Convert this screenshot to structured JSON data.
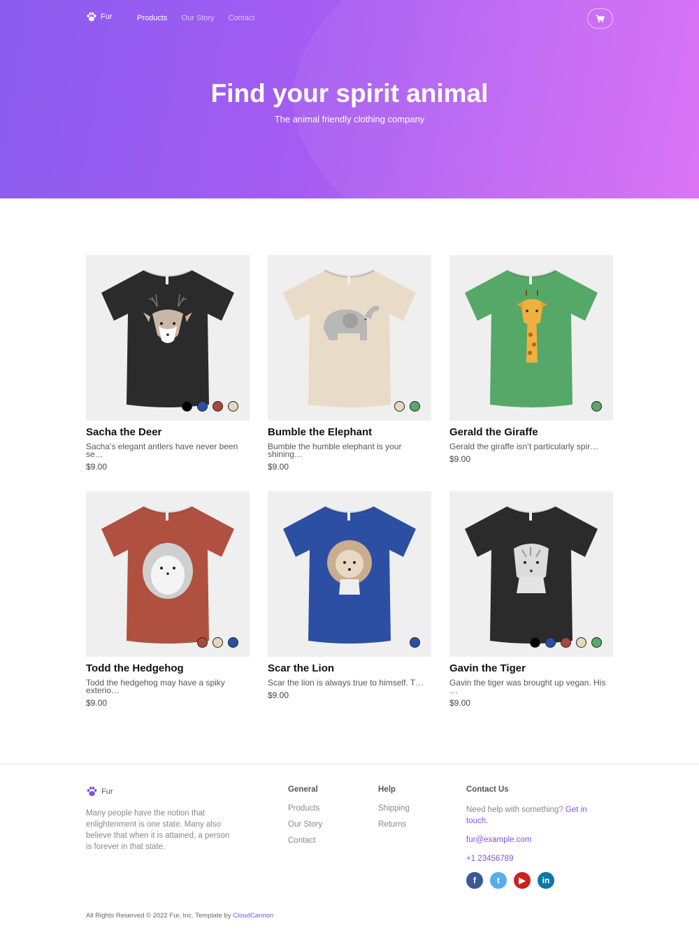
{
  "header": {
    "brand": "Fur",
    "nav": [
      {
        "label": "Products",
        "active": true
      },
      {
        "label": "Our Story",
        "active": false
      },
      {
        "label": "Contact",
        "active": false
      }
    ],
    "cart_icon": "cart-icon"
  },
  "hero": {
    "title": "Find your spirit animal",
    "subtitle": "The animal friendly clothing company"
  },
  "products": [
    {
      "name": "Sacha the Deer",
      "desc": "Sacha’s elegant antlers have never been se…",
      "price": "$9.00",
      "shirt": "#2b2b2b",
      "animal": "deer",
      "swatches": [
        "#000000",
        "#2b4fa8",
        "#a84a3a",
        "#e6d6c0"
      ]
    },
    {
      "name": "Bumble the Elephant",
      "desc": "Bumble the humble elephant is your shining…",
      "price": "$9.00",
      "shirt": "#e8dcc8",
      "animal": "elephant",
      "swatches": [
        "#e6d6c0",
        "#5aa86a"
      ]
    },
    {
      "name": "Gerald the Giraffe",
      "desc": "Gerald the giraffe isn’t particularly spir…",
      "price": "$9.00",
      "shirt": "#55a868",
      "animal": "giraffe",
      "swatches": [
        "#5aa86a"
      ]
    },
    {
      "name": "Todd the Hedgehog",
      "desc": "Todd the hedgehog may have a spiky exterio…",
      "price": "$9.00",
      "shirt": "#b05040",
      "animal": "hedgehog",
      "swatches": [
        "#a84a3a",
        "#e6d6c0",
        "#2b4fa8"
      ]
    },
    {
      "name": "Scar the Lion",
      "desc": "Scar the lion is always true to himself. T…",
      "price": "$9.00",
      "shirt": "#2c4fa3",
      "animal": "lion",
      "swatches": [
        "#2b4fa8"
      ]
    },
    {
      "name": "Gavin the Tiger",
      "desc": "Gavin the tiger was brought up vegan. His …",
      "price": "$9.00",
      "shirt": "#2b2b2b",
      "animal": "tiger",
      "swatches": [
        "#000000",
        "#2b4fa8",
        "#a84a3a",
        "#e6d6c0",
        "#5aa86a"
      ]
    }
  ],
  "footer": {
    "brand": "Fur",
    "about": "Many people have the notion that enlightenment is one state. Many also believe that when it is attained, a person is forever in that state.",
    "general": {
      "heading": "General",
      "links": [
        "Products",
        "Our Story",
        "Contact"
      ]
    },
    "help": {
      "heading": "Help",
      "links": [
        "Shipping",
        "Returns"
      ]
    },
    "contact": {
      "heading": "Contact Us",
      "text": "Need help with something? ",
      "link": "Get in touch.",
      "email": "fur@example.com",
      "phone": "+1 23456789",
      "socials": [
        {
          "icon": "facebook-icon",
          "glyph": "f",
          "color": "#3b5998"
        },
        {
          "icon": "twitter-icon",
          "glyph": "t",
          "color": "#55acee"
        },
        {
          "icon": "youtube-icon",
          "glyph": "▶",
          "color": "#cd201f"
        },
        {
          "icon": "linkedin-icon",
          "glyph": "in",
          "color": "#0e76a8"
        }
      ]
    },
    "copyright": "All Rights Reserved © 2022 Fur, Inc. Template by ",
    "credit": "CloudCannon"
  }
}
